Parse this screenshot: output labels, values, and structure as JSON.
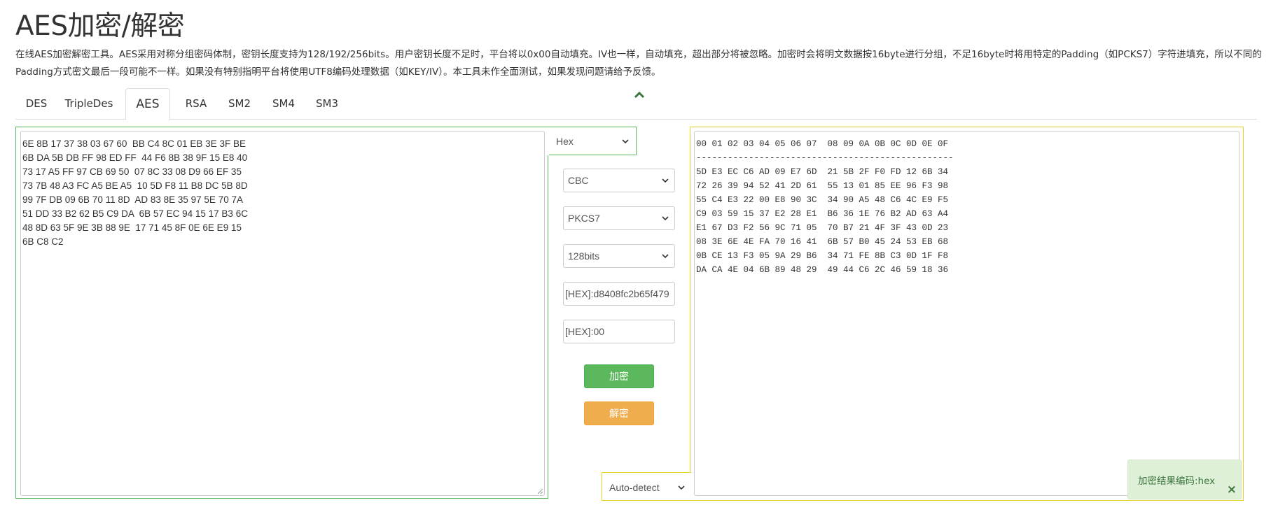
{
  "header": {
    "title": "AES加密/解密",
    "description": "在线AES加密解密工具。AES采用对称分组密码体制，密钥长度支持为128/192/256bits。用户密钥长度不足时，平台将以0x00自动填充。IV也一样，自动填充，超出部分将被忽略。加密时会将明文数据按16byte进行分组，不足16byte时将用特定的Padding（如PCKS7）字符进填充，所以不同的Padding方式密文最后一段可能不一样。如果没有特别指明平台将使用UTF8编码处理数据（如KEY/IV）。本工具未作全面测试，如果发现问题请给予反馈。"
  },
  "tabs": [
    {
      "label": "DES",
      "active": false
    },
    {
      "label": "TripleDes",
      "active": false
    },
    {
      "label": "AES",
      "active": true
    },
    {
      "label": "RSA",
      "active": false
    },
    {
      "label": "SM2",
      "active": false
    },
    {
      "label": "SM4",
      "active": false
    },
    {
      "label": "SM3",
      "active": false
    }
  ],
  "input": {
    "text": "6E 8B 17 37 38 03 67 60  BB C4 8C 01 EB 3E 3F BE\n6B DA 5B DB FF 98 ED FF  44 F6 8B 38 9F 15 E8 40\n73 17 A5 FF 97 CB 69 50  07 8C 33 08 D9 66 EF 35\n73 7B 48 A3 FC A5 BE A5  10 5D F8 11 B8 DC 5B 8D\n99 7F DB 09 6B 70 11 8D  AD 83 8E 35 97 5E 70 7A\n51 DD 33 B2 62 B5 C9 DA  6B 57 EC 94 15 17 B3 6C\n48 8D 63 5F 9E 3B 88 9E  17 71 45 8F 0E 6E E9 15\n6B C8 C2",
    "encoding": "Hex"
  },
  "controls": {
    "mode": "CBC",
    "padding": "PKCS7",
    "key_size": "128bits",
    "key": "[HEX]:d8408fc2b65f479",
    "iv": "[HEX]:00",
    "encrypt_label": "加密",
    "decrypt_label": "解密"
  },
  "output": {
    "encoding": "Auto-detect",
    "text": "00 01 02 03 04 05 06 07  08 09 0A 0B 0C 0D 0E 0F\n-------------------------------------------------\n5D E3 EC C6 AD 09 E7 6D  21 5B 2F F0 FD 12 6B 34\n72 26 39 94 52 41 2D 61  55 13 01 85 EE 96 F3 98\n55 C4 E3 22 00 E8 90 3C  34 90 A5 48 C6 4C E9 F5\nC9 03 59 15 37 E2 28 E1  B6 36 1E 76 B2 AD 63 A4\nE1 67 D3 F2 56 9C 71 05  70 B7 21 4F 3F 43 0D 23\n08 3E 6E 4E FA 70 16 41  6B 57 B0 45 24 53 EB 68\n0B CE 13 F3 05 9A 29 B6  34 71 FE 8B C3 0D 1F F8\nDA CA 4E 04 6B 89 48 29  49 44 C6 2C 46 59 18 36"
  },
  "toast": {
    "message": "加密结果编码:hex",
    "close": "×"
  },
  "colors": {
    "input_border": "#5cb85c",
    "output_border": "#e6d32a",
    "encrypt_button": "#5cb85c",
    "decrypt_button": "#f0ad4e",
    "toast_bg": "#dff0d8"
  }
}
